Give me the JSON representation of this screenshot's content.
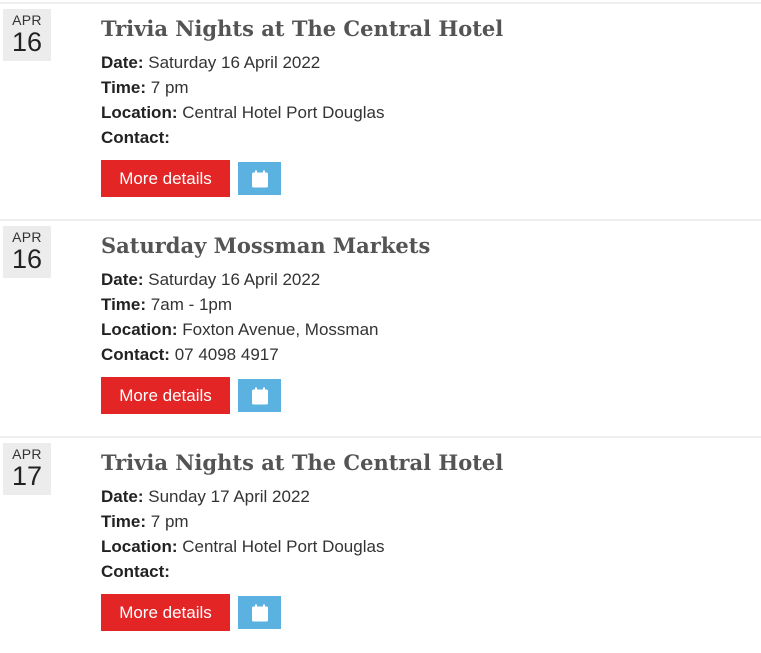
{
  "colors": {
    "details_button": "#e32526",
    "calendar_button": "#5bb1df",
    "date_badge_bg": "#ececec",
    "title_color": "#545454"
  },
  "labels": {
    "date": "Date:",
    "time": "Time:",
    "location": "Location:",
    "contact": "Contact:",
    "more_details": "More details",
    "calendar_icon": "calendar-icon"
  },
  "events": [
    {
      "month": "APR",
      "day": "16",
      "title": "Trivia Nights at The Central Hotel",
      "date": "Saturday 16 April 2022",
      "time": "7 pm",
      "location": "Central Hotel Port Douglas",
      "contact": ""
    },
    {
      "month": "APR",
      "day": "16",
      "title": "Saturday Mossman Markets",
      "date": "Saturday 16 April 2022",
      "time": "7am - 1pm",
      "location": "Foxton Avenue, Mossman",
      "contact": "07 4098 4917"
    },
    {
      "month": "APR",
      "day": "17",
      "title": "Trivia Nights at The Central Hotel",
      "date": "Sunday 17 April 2022",
      "time": "7 pm",
      "location": "Central Hotel Port Douglas",
      "contact": ""
    }
  ]
}
